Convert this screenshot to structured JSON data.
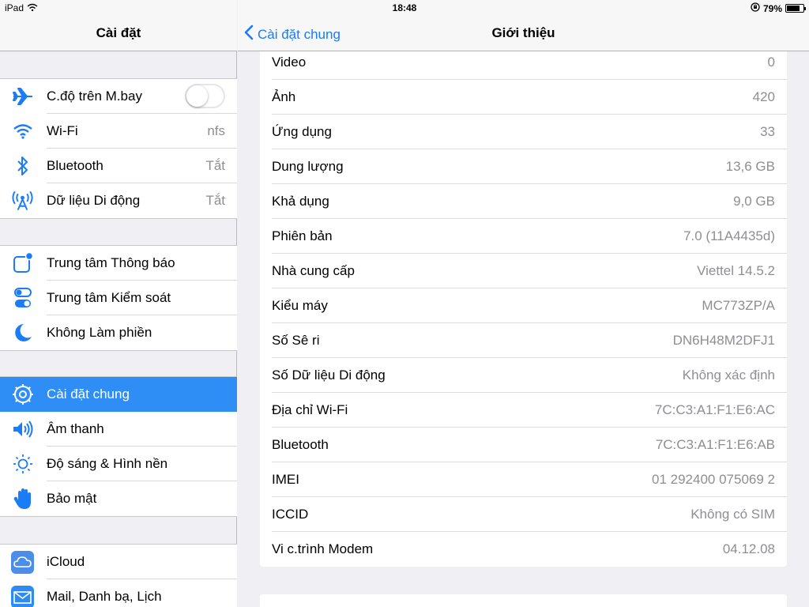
{
  "status": {
    "device": "iPad",
    "time": "18:48",
    "battery_percent": "79%",
    "battery_level": 0.79
  },
  "sidebar": {
    "title": "Cài đặt",
    "groups": [
      [
        {
          "label": "C.độ trên M.bay",
          "icon": "airplane-icon",
          "toggle": false
        },
        {
          "label": "Wi-Fi",
          "value": "nfs",
          "icon": "wifi-icon"
        },
        {
          "label": "Bluetooth",
          "value": "Tắt",
          "icon": "bluetooth-icon"
        },
        {
          "label": "Dữ liệu Di động",
          "value": "Tắt",
          "icon": "cellular-icon"
        }
      ],
      [
        {
          "label": "Trung tâm Thông báo",
          "icon": "notification-center-icon"
        },
        {
          "label": "Trung tâm Kiểm soát",
          "icon": "control-center-icon"
        },
        {
          "label": "Không Làm phiền",
          "icon": "moon-icon"
        }
      ],
      [
        {
          "label": "Cài đặt chung",
          "icon": "gear-icon",
          "selected": true
        },
        {
          "label": "Âm thanh",
          "icon": "speaker-icon"
        },
        {
          "label": "Độ sáng & Hình nền",
          "icon": "brightness-icon"
        },
        {
          "label": "Bảo mật",
          "icon": "hand-icon"
        }
      ],
      [
        {
          "label": "iCloud",
          "icon": "icloud-icon"
        },
        {
          "label": "Mail, Danh bạ, Lịch",
          "icon": "mail-icon"
        }
      ]
    ]
  },
  "detail": {
    "back_label": "Cài đặt chung",
    "title": "Giới thiệu",
    "rows": [
      {
        "key": "Video",
        "value": "0"
      },
      {
        "key": "Ảnh",
        "value": "420"
      },
      {
        "key": "Ứng dụng",
        "value": "33"
      },
      {
        "key": "Dung lượng",
        "value": "13,6 GB"
      },
      {
        "key": "Khả dụng",
        "value": "9,0 GB"
      },
      {
        "key": "Phiên bản",
        "value": "7.0 (11A4435d)"
      },
      {
        "key": "Nhà cung cấp",
        "value": "Viettel 14.5.2"
      },
      {
        "key": "Kiểu máy",
        "value": "MC773ZP/A"
      },
      {
        "key": "Số Sê ri",
        "value": "DN6H48M2DFJ1"
      },
      {
        "key": "Số Dữ liệu Di động",
        "value": "Không xác định"
      },
      {
        "key": "Địa chỉ Wi-Fi",
        "value": "7C:C3:A1:F1:E6:AC"
      },
      {
        "key": "Bluetooth",
        "value": "7C:C3:A1:F1:E6:AB"
      },
      {
        "key": "IMEI",
        "value": "01 292400 075069 2"
      },
      {
        "key": "ICCID",
        "value": "Không có SIM"
      },
      {
        "key": "Vi c.trình Modem",
        "value": "04.12.08"
      }
    ]
  },
  "colors": {
    "accent": "#1a7cf6",
    "selected_row": "#2f8ef5",
    "secondary_text": "#8e8e93"
  }
}
